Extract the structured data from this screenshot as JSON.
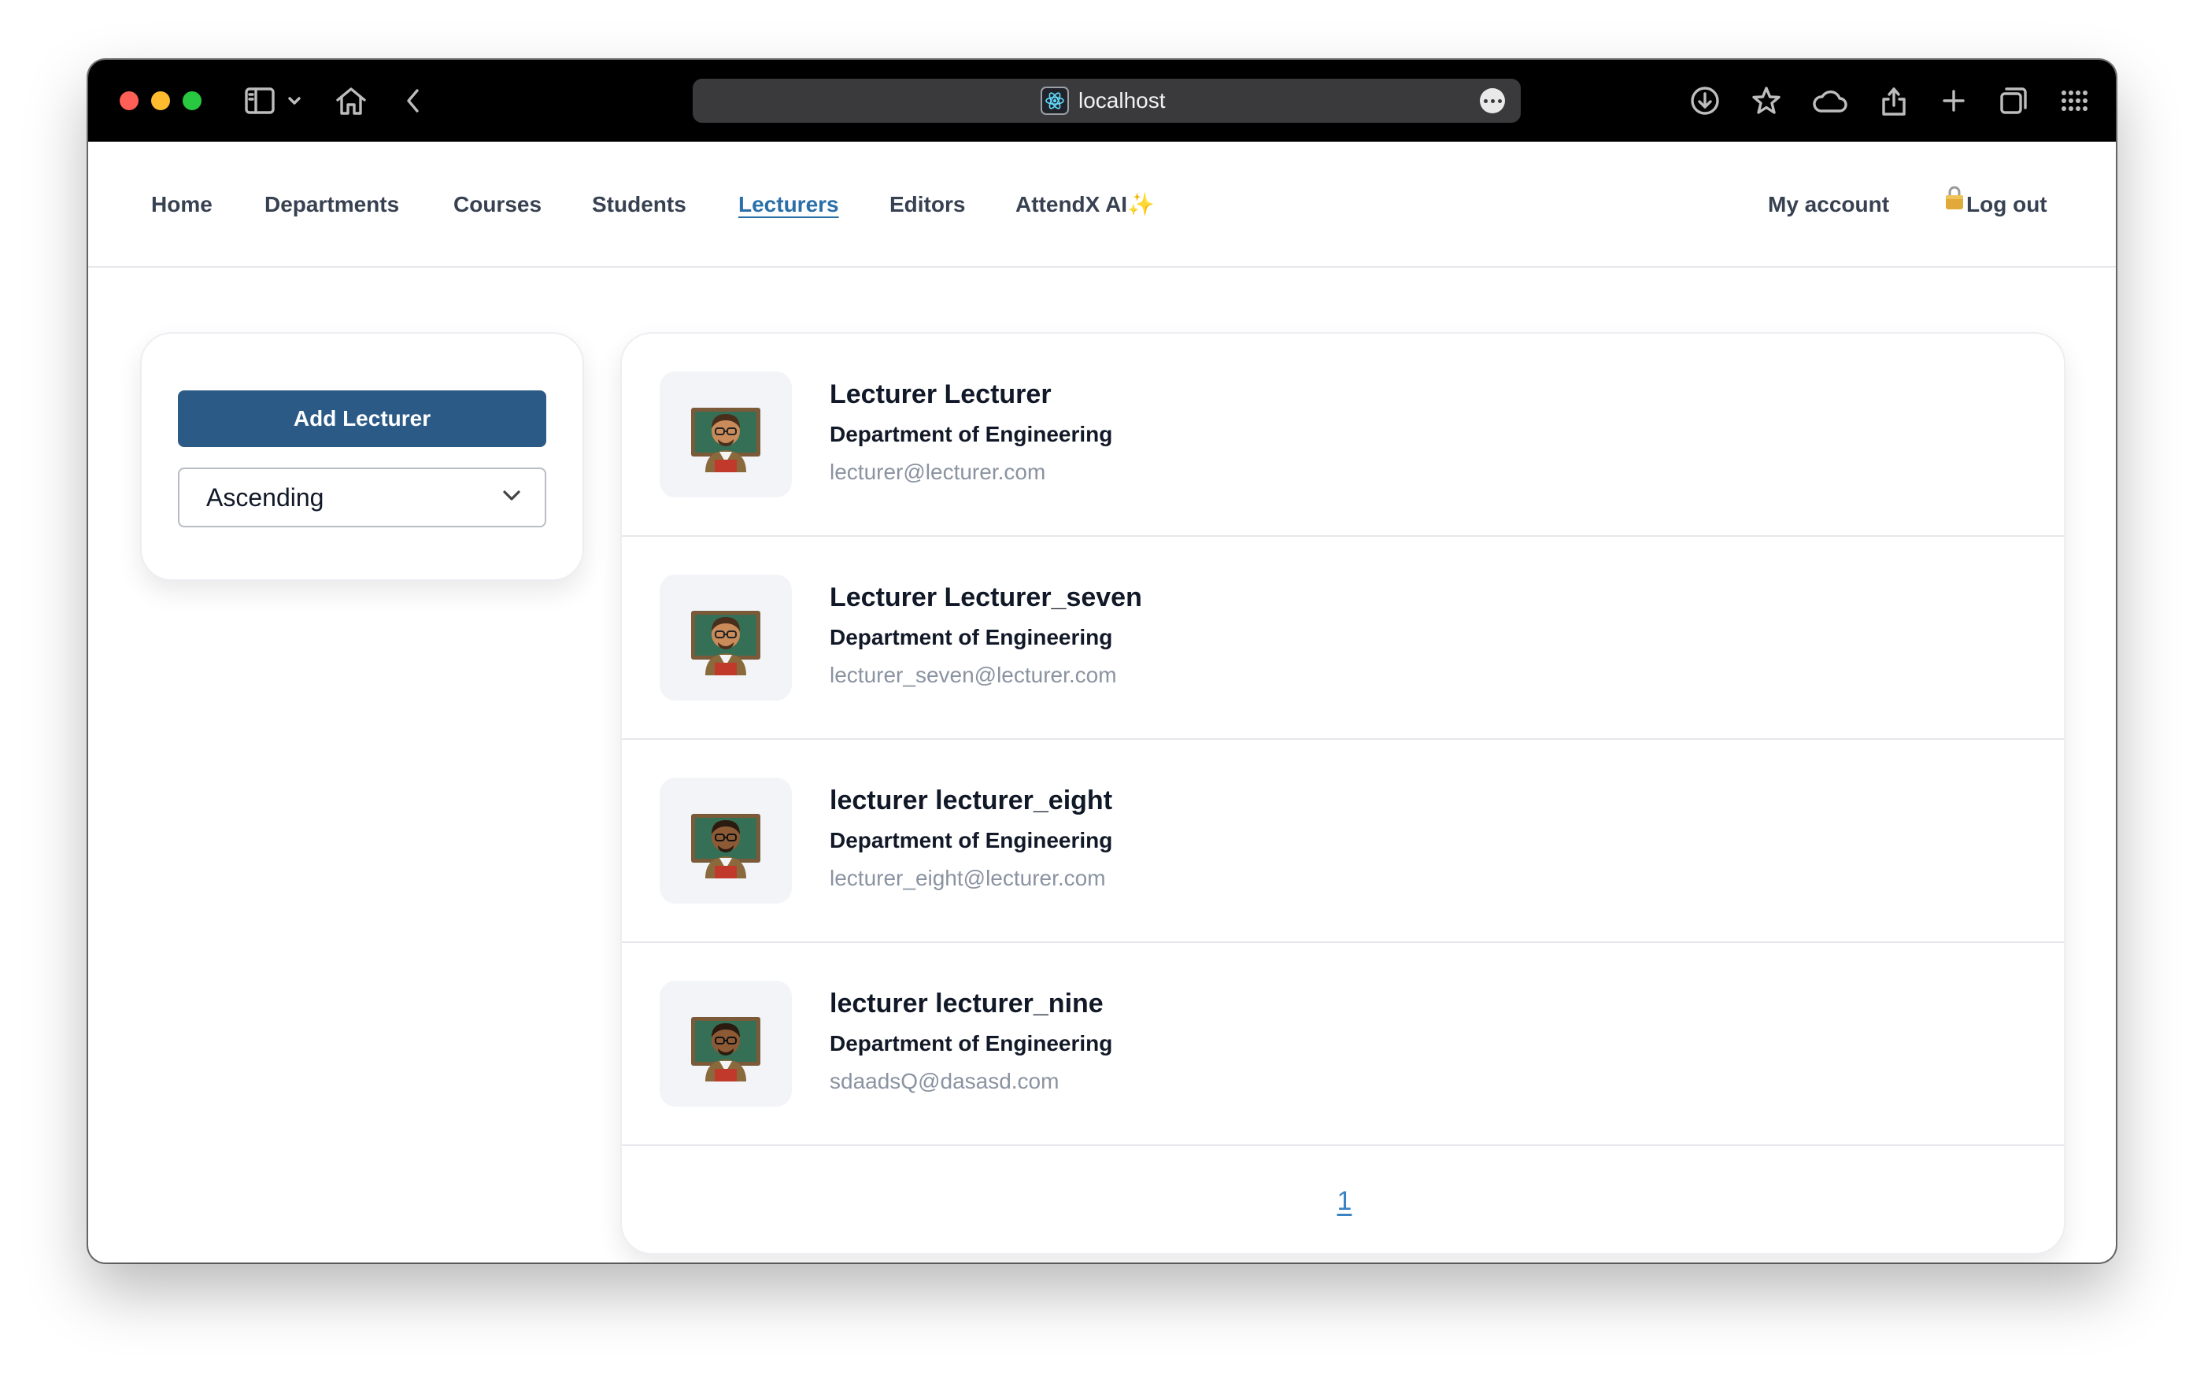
{
  "browser": {
    "url": "localhost"
  },
  "nav": {
    "links": [
      {
        "label": "Home"
      },
      {
        "label": "Departments"
      },
      {
        "label": "Courses"
      },
      {
        "label": "Students"
      },
      {
        "label": "Lecturers"
      },
      {
        "label": "Editors"
      },
      {
        "label": "AttendX AI"
      }
    ],
    "ai_sparkle": "✨",
    "active": "Lecturers",
    "account": "My account",
    "logout": "Log out"
  },
  "sidebar": {
    "add_button": "Add Lecturer",
    "sort_value": "Ascending"
  },
  "lecturers": [
    {
      "name": "Lecturer Lecturer",
      "department": "Department of Engineering",
      "email": "lecturer@lecturer.com",
      "skin": "#c98b5a"
    },
    {
      "name": "Lecturer Lecturer_seven",
      "department": "Department of Engineering",
      "email": "lecturer_seven@lecturer.com",
      "skin": "#c98b5a"
    },
    {
      "name": "lecturer lecturer_eight",
      "department": "Department of Engineering",
      "email": "lecturer_eight@lecturer.com",
      "skin": "#8d5a36"
    },
    {
      "name": "lecturer lecturer_nine",
      "department": "Department of Engineering",
      "email": "sdaadsQ@dasasd.com",
      "skin": "#8d5a36"
    }
  ],
  "pagination": {
    "current_page": "1"
  },
  "colors": {
    "primary": "#2b5a86",
    "active_link": "#2a6fa8",
    "email_text": "#8a93a1"
  }
}
